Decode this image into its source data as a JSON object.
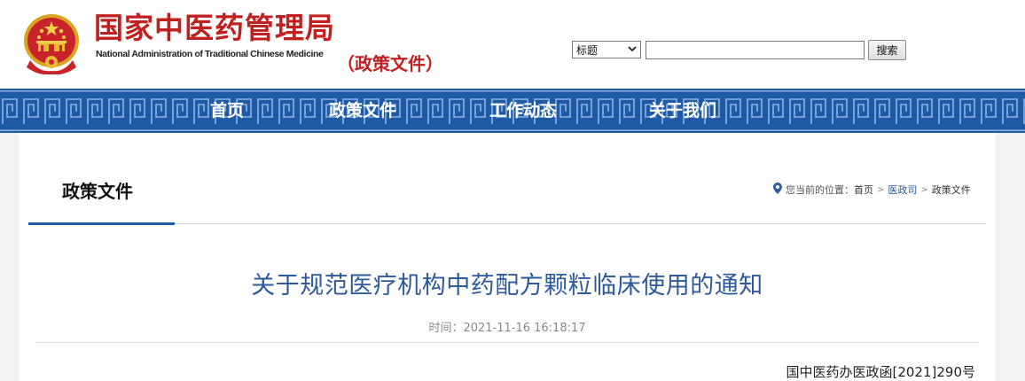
{
  "header": {
    "title": "国家中医药管理局",
    "subtitle": "National Administration of Traditional Chinese Medicine",
    "section_label": "（政策文件）"
  },
  "search": {
    "select_value": "标题",
    "input_value": "",
    "button_label": "搜索"
  },
  "nav": {
    "items": [
      {
        "label": "首页"
      },
      {
        "label": "政策文件"
      },
      {
        "label": "工作动态"
      },
      {
        "label": "关于我们"
      }
    ]
  },
  "content": {
    "tab_title": "政策文件",
    "breadcrumb": {
      "prefix": "您当前的位置：",
      "items": [
        "首页",
        "医政司",
        "政策文件"
      ],
      "separator": ">"
    },
    "article": {
      "title": "关于规范医疗机构中药配方颗粒临床使用的通知",
      "time": "时间：2021-11-16 16:18:17",
      "doc_number": "国中医药办医政函[2021]290号"
    }
  },
  "colors": {
    "brand_red": "#c0201f",
    "nav_blue": "#1f5aa6",
    "title_blue": "#2e5a9c"
  },
  "icons": {
    "emblem": "national-emblem-icon",
    "location": "location-pin-icon",
    "dropdown": "chevron-down-icon"
  }
}
